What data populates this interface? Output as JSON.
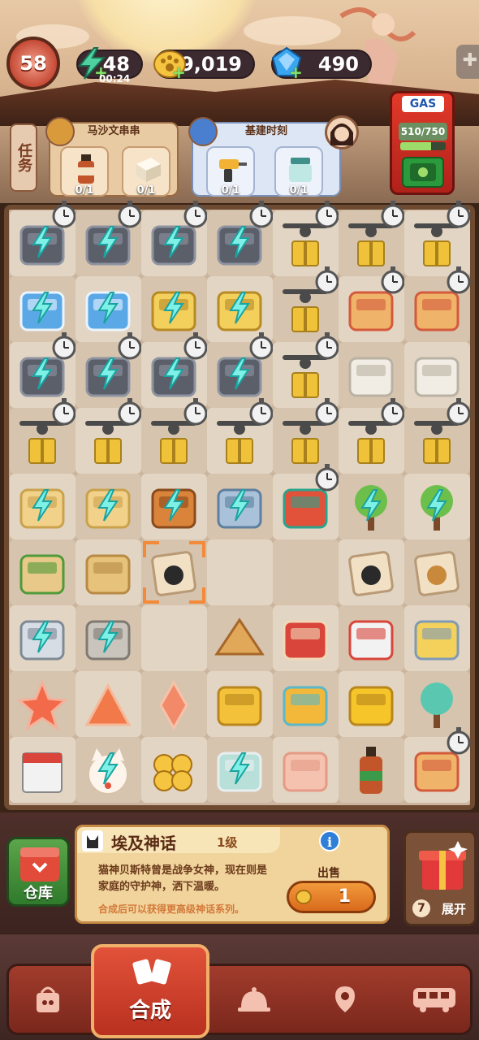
{
  "header": {
    "level": "58",
    "energy": {
      "value": "48",
      "timer": "00:24",
      "icon": "lightning-icon"
    },
    "coins": {
      "value": "29,019",
      "icon": "paw-coin-icon"
    },
    "gems": {
      "value": "490",
      "icon": "diamond-icon"
    },
    "puzzle_icon": "puzzle-piece-icon"
  },
  "tasks": {
    "tab_label": "任务",
    "orders": [
      {
        "title": "马沙文串串",
        "items": [
          {
            "icon": "sauce-bottle-icon",
            "count": "0/1"
          },
          {
            "icon": "tofu-icon",
            "count": "0/1"
          }
        ]
      },
      {
        "title": "基建时刻",
        "items": [
          {
            "icon": "power-drill-icon",
            "count": "0/1"
          },
          {
            "icon": "paint-jar-icon",
            "count": "0/1"
          }
        ]
      }
    ]
  },
  "gas_pump": {
    "label": "GAS",
    "value": "510/750",
    "fill": 0.68
  },
  "board": {
    "rows": [
      [
        "film-camera",
        "film-camera",
        "film-camera",
        "film-camera",
        "drone-box",
        "drone-box",
        "drone-box"
      ],
      [
        "blue-notebook",
        "blue-notebook",
        "grain-sack",
        "grain-sack",
        "drone-box",
        "bread-box",
        "bread-box"
      ],
      [
        "film-camera",
        "film-camera",
        "film-camera",
        "film-camera",
        "drone-box",
        "white-printer",
        "white-printer"
      ],
      [
        "drone-box",
        "drone-box",
        "drone-box",
        "drone-box",
        "drone-box",
        "drone-box",
        "drone-box"
      ],
      [
        "vending-machine",
        "vending-machine",
        "copper-pot",
        "locker",
        "peacock-feather",
        "green-tree",
        "green-tree"
      ],
      [
        "green-snack-plate",
        "seed-pile",
        "egyptian-cat-tile",
        "",
        "",
        "egyptian-cat-tile",
        "lion-tile"
      ],
      [
        "safe-box",
        "printer-grey",
        "",
        "pyramid",
        "red-bag",
        "robot-toy",
        "gold-key-tray"
      ],
      [
        "red-star",
        "orange-triangle",
        "pink-diamond",
        "gold-bow",
        "gold-sword",
        "gold-apple",
        "bonsai-tree"
      ],
      [
        "calendar",
        "lucky-cat",
        "paw-coins",
        "hotpot",
        "pink-cloth",
        "sauce-bottle",
        "bread-box"
      ]
    ]
  },
  "info_card": {
    "title": "埃及神话",
    "level": "1级",
    "description": "猫神贝斯特曾是战争女神，现在则是家庭的守护神，洒下温暖。",
    "hint": "合成后可以获得更高级神话系列。",
    "sell_label": "出售",
    "sell_value": "1",
    "info_icon": "info-icon"
  },
  "warehouse": {
    "label": "仓库"
  },
  "gift": {
    "count": "7",
    "label": "展开"
  },
  "nav": {
    "items": [
      {
        "icon": "shopping-bag-icon"
      },
      {
        "label": "合成",
        "icon": "cards-icon"
      },
      {
        "icon": "service-bell-icon"
      },
      {
        "icon": "map-pin-icon"
      },
      {
        "icon": "bus-icon"
      }
    ]
  },
  "colors": {
    "energy_green": "#4fd0a0",
    "coin_gold": "#f5c542",
    "gem_blue": "#3ba6f0",
    "board_frame": "#6e4a30"
  }
}
